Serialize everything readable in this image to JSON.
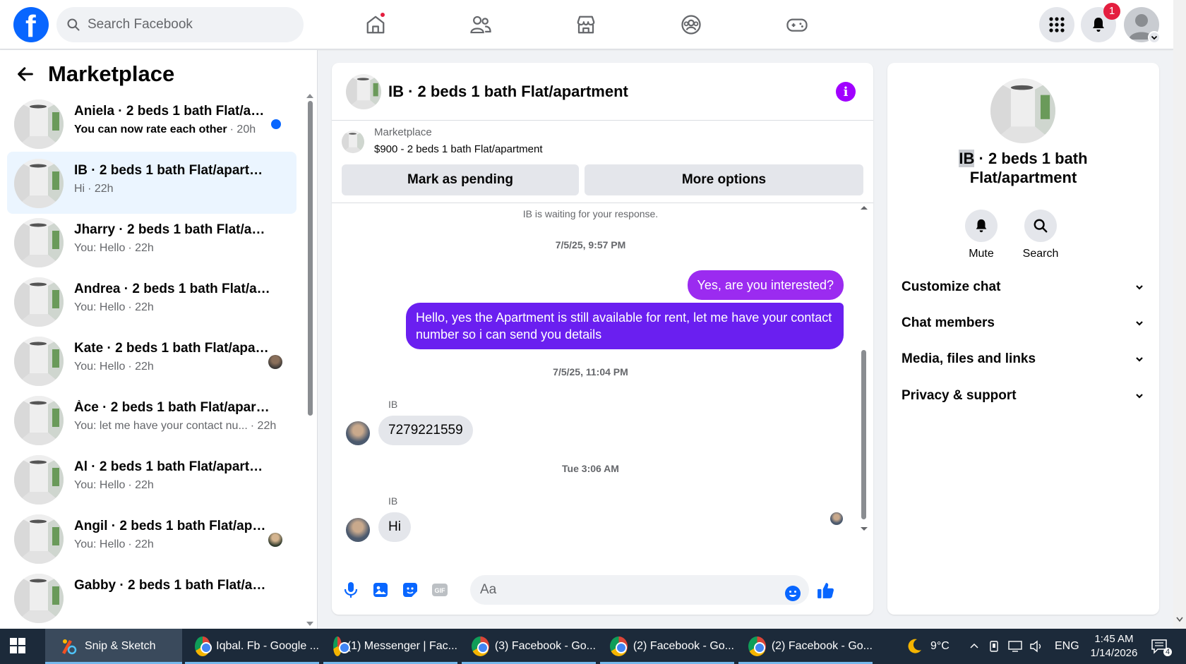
{
  "topbar": {
    "search_placeholder": "Search Facebook",
    "notification_count": "1",
    "nav_icons": [
      "home-icon",
      "friends-icon",
      "marketplace-icon",
      "groups-icon",
      "gaming-icon"
    ]
  },
  "sidebar": {
    "title": "Marketplace",
    "conversations": [
      {
        "name": "Aniela · 2 beds 1 bath Flat/apa...",
        "message": "You can now rate each other",
        "time": "· 20h",
        "unread": true
      },
      {
        "name": "IB · 2 beds 1 bath Flat/apartment",
        "message": "Hi",
        "time": "· 22h",
        "active": true
      },
      {
        "name": "Jharry · 2 beds 1 bath Flat/apart...",
        "message": "You: Hello",
        "time": "· 22h"
      },
      {
        "name": "Andrea · 2 beds 1 bath Flat/apar...",
        "message": "You: Hello",
        "time": "· 22h"
      },
      {
        "name": "Kate · 2 beds 1 bath Flat/apart...",
        "message": "You: Hello",
        "time": "· 22h"
      },
      {
        "name": "Àce · 2 beds 1 bath Flat/apartme...",
        "message": "You: let me have your contact nu...",
        "time": "· 22h"
      },
      {
        "name": "Al · 2 beds 1 bath Flat/apartment",
        "message": "You: Hello",
        "time": "· 22h"
      },
      {
        "name": "Angil · 2 beds 1 bath Flat/apar...",
        "message": "You: Hello",
        "time": "· 22h"
      },
      {
        "name": "Gabby · 2 beds 1 bath Flat/apart...",
        "message": "",
        "time": ""
      }
    ]
  },
  "chat": {
    "title": "IB · 2 beds 1 bath Flat/apartment",
    "marketplace_label": "Marketplace",
    "listing": "$900 - 2 beds 1 bath Flat/apartment",
    "mark_pending": "Mark as pending",
    "more_options": "More options",
    "waiting_notice": "IB is waiting for your response.",
    "timestamp1": "7/5/25, 9:57 PM",
    "out_msg1": "Yes, are you interested?",
    "out_msg2": "Hello, yes the Apartment is still available for rent, let me have your contact number so i can send you details",
    "timestamp2": "7/5/25, 11:04 PM",
    "sender1": "IB",
    "in_msg1": "7279221559",
    "timestamp3": "Tue 3:06 AM",
    "sender2": "IB",
    "in_msg2": "Hi",
    "composer_placeholder": "Aa"
  },
  "details": {
    "title_highlight": "IB",
    "title_rest": " · 2 beds 1 bath Flat/apartment",
    "mute": "Mute",
    "search": "Search",
    "sections": [
      "Customize chat",
      "Chat members",
      "Media, files and links",
      "Privacy & support"
    ]
  },
  "taskbar": {
    "apps": [
      {
        "label": "Snip & Sketch",
        "icon": "snip-sketch-icon"
      },
      {
        "label": "Iqbal. Fb - Google ...",
        "icon": "chrome-icon"
      },
      {
        "label": "(1) Messenger | Fac...",
        "icon": "chrome-icon"
      },
      {
        "label": "(3) Facebook - Go...",
        "icon": "chrome-icon"
      },
      {
        "label": "(2) Facebook - Go...",
        "icon": "chrome-icon"
      },
      {
        "label": "(2) Facebook - Go...",
        "icon": "chrome-icon"
      }
    ],
    "weather": "9°C",
    "language": "ENG",
    "time": "1:45 AM",
    "date": "1/14/2026",
    "notification_count": "4"
  },
  "colors": {
    "brand_blue": "#0866ff",
    "outgoing_bubble": "#7b2ff0",
    "info_purple": "#a100ff"
  }
}
